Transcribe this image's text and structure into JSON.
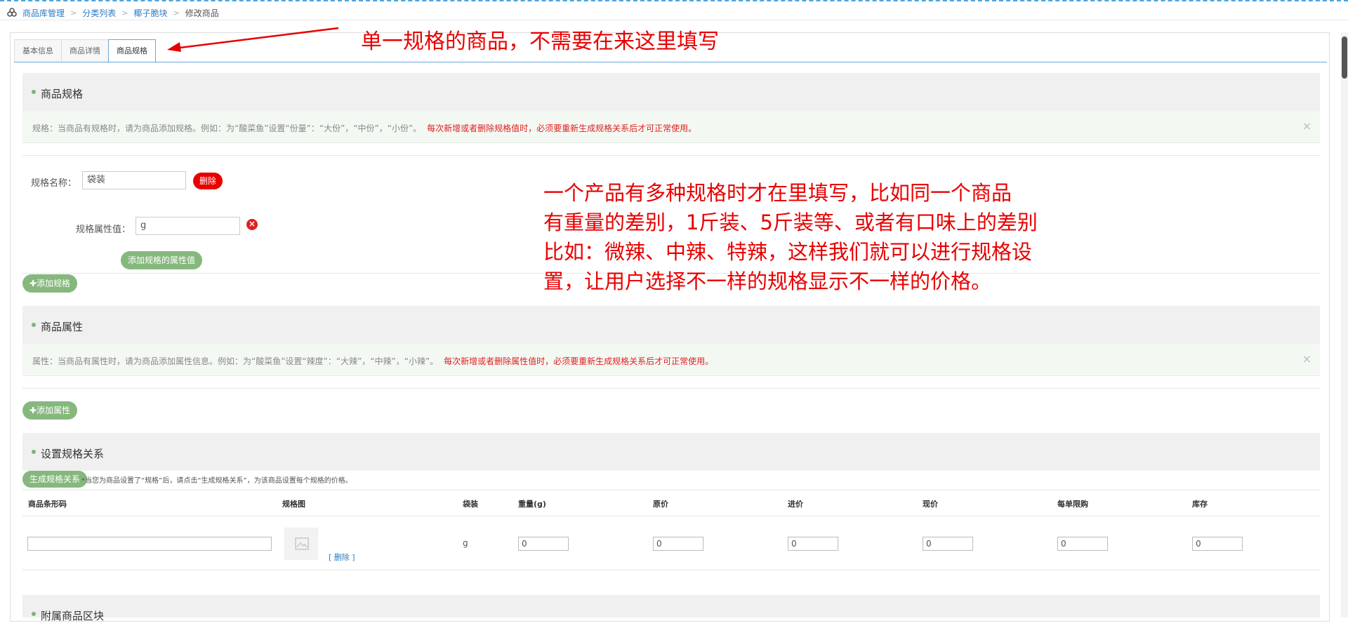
{
  "breadcrumb": {
    "items": [
      "商品库管理",
      "分类列表",
      "椰子脆块",
      "修改商品"
    ]
  },
  "tabs": [
    {
      "label": "基本信息"
    },
    {
      "label": "商品详情"
    },
    {
      "label": "商品规格"
    }
  ],
  "annotations": {
    "top": "单一规格的商品，不需要在来这里填写",
    "middle_lines": [
      "一个产品有多种规格时才在里填写，比如同一个商品",
      "有重量的差别，1斤装、5斤装等、或者有口味上的差别",
      "比如：微辣、中辣、特辣，这样我们就可以进行规格设",
      "置，让用户选择不一样的规格显示不一样的价格。"
    ]
  },
  "spec_section": {
    "title": "商品规格",
    "notice": "规格：当商品有规格时，请为商品添加规格。例如：为“酸菜鱼”设置“份量”：“大份”，“中份”，“小份”。",
    "notice_red": "每次新增或者删除规格值时，必须要重新生成规格关系后才可正常使用。",
    "close": "×",
    "name_label": "规格名称：",
    "name_value": "袋装",
    "delete_label": "删除",
    "attr_label": "规格属性值：",
    "attr_value": "g",
    "attr_remove": "×",
    "add_attr_value_label": "添加规格的属性值",
    "add_spec_label": "✚添加规格"
  },
  "attr_section": {
    "title": "商品属性",
    "notice": "属性：当商品有属性时，请为商品添加属性信息。例如：为“酸菜鱼”设置“辣度”：“大辣”，“中辣”，“小辣”。",
    "notice_red": "每次新增或者删除属性值时，必须要重新生成规格关系后才可正常使用。",
    "close": "×",
    "add_attr_label": "✚添加属性"
  },
  "relation_section": {
    "title": "设置规格关系",
    "generate_label": "生成规格关系",
    "hint": "*当您为商品设置了“规格”后，请点击“生成规格关系”，为该商品设置每个规格的价格。",
    "columns": [
      "商品条形码",
      "规格图",
      "袋装",
      "重量(g)",
      "原价",
      "进价",
      "现价",
      "每单限购",
      "库存"
    ],
    "row": {
      "barcode": "",
      "image_delete": "[ 删除 ]",
      "spec_value": "g",
      "weight": "0",
      "original_price": "0",
      "cost_price": "0",
      "current_price": "0",
      "limit": "0",
      "stock": "0"
    }
  },
  "extra_section": {
    "title": "附属商品区块"
  },
  "colors": {
    "accent_green": "#86b87e",
    "danger_red": "#e80000",
    "link_blue": "#2b7bc3",
    "annotation_red": "#e80000"
  }
}
